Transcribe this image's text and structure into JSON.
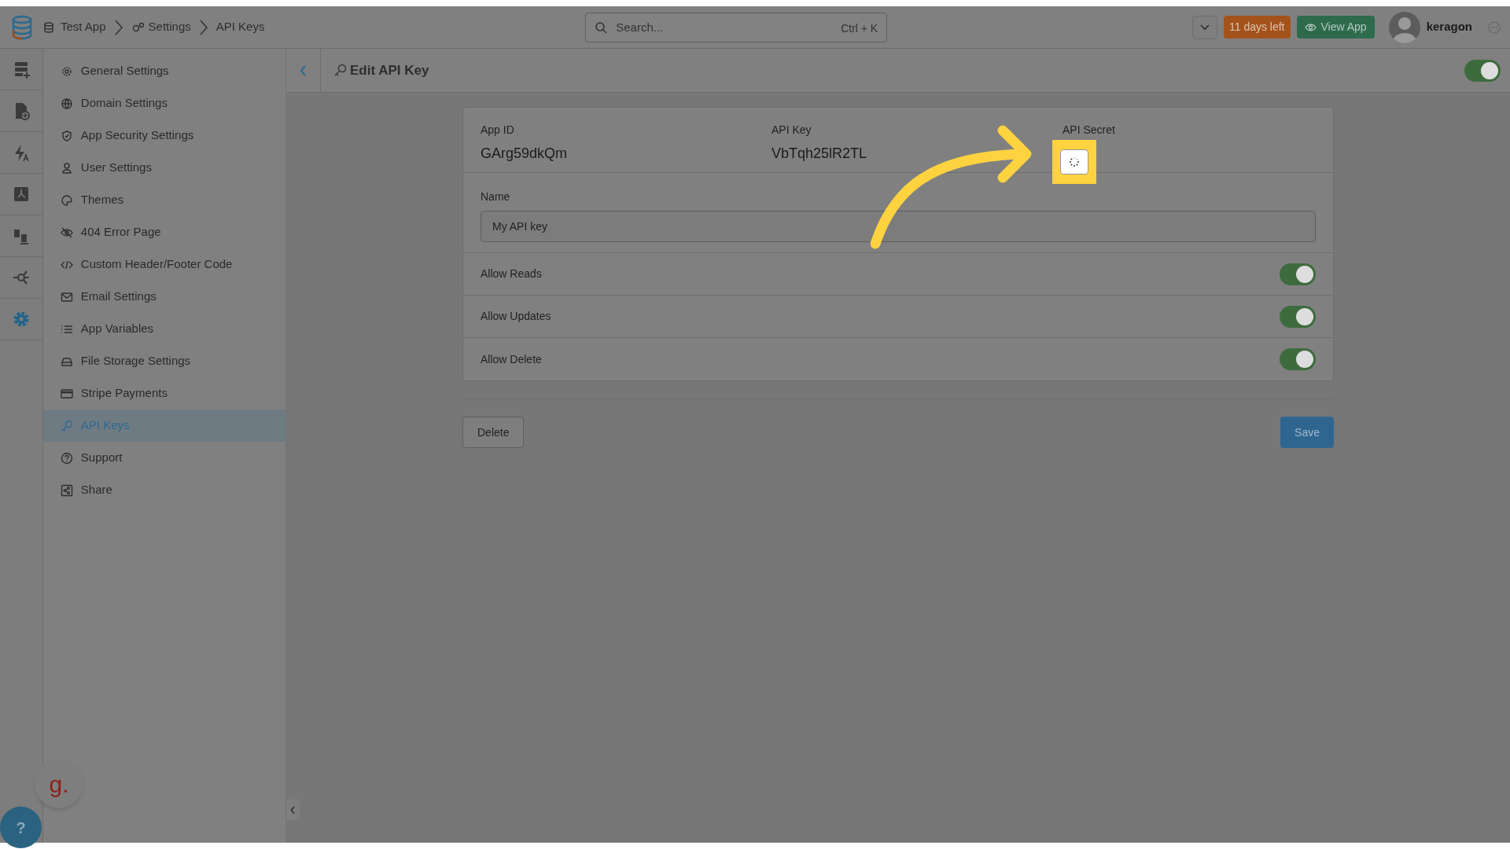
{
  "breadcrumb": [
    {
      "label": "Test App",
      "kind": "app"
    },
    {
      "label": "Settings",
      "kind": "settings"
    },
    {
      "label": "API Keys",
      "kind": "plain"
    }
  ],
  "search": {
    "placeholder": "Search...",
    "shortcut": "Ctrl + K"
  },
  "trial_badge": "11 days left",
  "view_app_button": "View App",
  "user": {
    "name": "keragon"
  },
  "rail": [
    {
      "selected": false
    },
    {
      "selected": false
    },
    {
      "selected": false
    },
    {
      "selected": false
    },
    {
      "selected": false
    },
    {
      "selected": false
    },
    {
      "selected": true
    }
  ],
  "sidebar": {
    "items": [
      {
        "label": "General Settings",
        "selected": false
      },
      {
        "label": "Domain Settings",
        "selected": false
      },
      {
        "label": "App Security Settings",
        "selected": false
      },
      {
        "label": "User Settings",
        "selected": false
      },
      {
        "label": "Themes",
        "selected": false
      },
      {
        "label": "404 Error Page",
        "selected": false
      },
      {
        "label": "Custom Header/Footer Code",
        "selected": false
      },
      {
        "label": "Email Settings",
        "selected": false
      },
      {
        "label": "App Variables",
        "selected": false
      },
      {
        "label": "File Storage Settings",
        "selected": false
      },
      {
        "label": "Stripe Payments",
        "selected": false
      },
      {
        "label": "API Keys",
        "selected": true
      },
      {
        "label": "Support",
        "selected": false
      },
      {
        "label": "Share",
        "selected": false
      }
    ]
  },
  "page": {
    "title": "Edit API Key",
    "header_toggle_on": true
  },
  "key_fields": [
    {
      "label": "App ID",
      "value": "GArg59dkQm",
      "kind": "text"
    },
    {
      "label": "API Key",
      "value": "VbTqh25lR2TL",
      "kind": "text"
    },
    {
      "label": "API Secret",
      "kind": "loading"
    }
  ],
  "name_field": {
    "label": "Name",
    "value": "My API key"
  },
  "permissions": [
    {
      "label": "Allow Reads",
      "on": true
    },
    {
      "label": "Allow Updates",
      "on": true
    },
    {
      "label": "Allow Delete",
      "on": true
    }
  ],
  "buttons": {
    "delete": "Delete",
    "save": "Save"
  },
  "help_button": "?",
  "chat_bubble": "g."
}
